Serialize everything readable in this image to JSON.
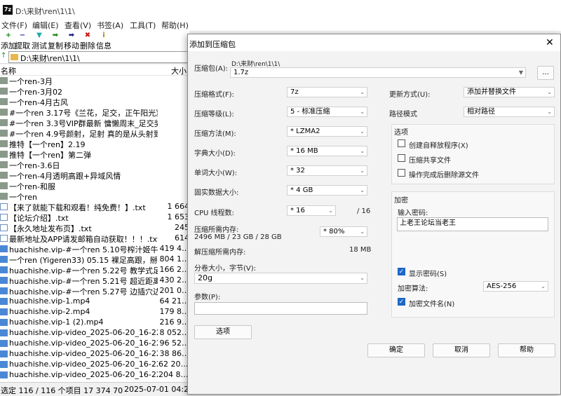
{
  "main": {
    "app_icon": "7z",
    "title": "D:\\来财\\ren\\1\\1\\",
    "menu": [
      "文件(F)",
      "编辑(E)",
      "查看(V)",
      "书签(A)",
      "工具(T)",
      "帮助(H)"
    ],
    "toolbar": [
      {
        "icon": "+",
        "label": "添加"
      },
      {
        "icon": "−",
        "label": "提取"
      },
      {
        "icon": "▼",
        "label": "测试"
      },
      {
        "icon": "➡",
        "label": "复制"
      },
      {
        "icon": "➡",
        "label": "移动"
      },
      {
        "icon": "✖",
        "label": "删除"
      },
      {
        "icon": "i",
        "label": "信息"
      }
    ],
    "address": "D:\\来财\\ren\\1\\1\\",
    "columns": {
      "name": "名称",
      "size": "大小"
    },
    "files": [
      {
        "type": "folder",
        "name": "一个ren-3月",
        "size": ""
      },
      {
        "type": "folder",
        "name": "一个ren-3月02",
        "size": ""
      },
      {
        "type": "folder",
        "name": "一个ren-4月古风",
        "size": ""
      },
      {
        "type": "folder",
        "name": "#一个ren 3.17号《兰花，足交，正午阳光》…",
        "size": ""
      },
      {
        "type": "folder",
        "name": "#一个ren 3.3号VIP群最新 慵懒周末_足交奖…",
        "size": ""
      },
      {
        "type": "folder",
        "name": "#一个ren 4.9号颜射，足射 真的是从头射到…",
        "size": ""
      },
      {
        "type": "folder",
        "name": "推特【一个ren】2.19",
        "size": ""
      },
      {
        "type": "folder",
        "name": "推特【一个ren】第二弹",
        "size": ""
      },
      {
        "type": "folder",
        "name": "一个ren-3.6日",
        "size": ""
      },
      {
        "type": "folder",
        "name": "一个ren-4月透明高跟+异域风情",
        "size": ""
      },
      {
        "type": "folder",
        "name": "一个ren-和服",
        "size": ""
      },
      {
        "type": "folder",
        "name": "一个ren",
        "size": ""
      },
      {
        "type": "file",
        "name": "【来了就能下载和观看！纯免费！】.txt",
        "size": "1 664"
      },
      {
        "type": "file",
        "name": "【论坛介绍】.txt",
        "size": "1 653"
      },
      {
        "type": "file",
        "name": "【永久地址发布页】.txt",
        "size": "245"
      },
      {
        "type": "file",
        "name": "最新地址及APP请发邮箱自动获取！！！.txt",
        "size": "614"
      },
      {
        "type": "media",
        "name": "huachishe.vip-#一个ren 5.10号榨汁姬牛奶…",
        "size": "419 4…"
      },
      {
        "type": "media",
        "name": "一个ren (Yigeren33) 05.15 裸足高跟，掰穴…",
        "size": "804 1…"
      },
      {
        "type": "media",
        "name": "huachishe.vip-#一个ren 5.22号 教学式足交…",
        "size": "166 2…"
      },
      {
        "type": "media",
        "name": "huachishe.vip-#一个ren 5.21号 超近距离口…",
        "size": "430 2…"
      },
      {
        "type": "media",
        "name": "huachishe.vip-#一个ren 5.27号 边插穴边玩…",
        "size": "201 0…"
      },
      {
        "type": "media",
        "name": "huachishe.vip-1.mp4",
        "size": "64 21…"
      },
      {
        "type": "media",
        "name": "huachishe.vip-2.mp4",
        "size": "179 8…"
      },
      {
        "type": "media",
        "name": "huachishe.vip-1 (2).mp4",
        "size": "216 9…"
      },
      {
        "type": "media",
        "name": "huachishe.vip-video_2025-06-20_16-22-1…",
        "size": "8 052…"
      },
      {
        "type": "media",
        "name": "huachishe.vip-video_2025-06-20_16-22-1…",
        "size": "96 52…"
      },
      {
        "type": "media",
        "name": "huachishe.vip-video_2025-06-20_16-22-1…",
        "size": "38 86…"
      },
      {
        "type": "media",
        "name": "huachishe.vip-video_2025-06-20_16-22-1…",
        "size": "62 20… 2025-…  2025-…"
      },
      {
        "type": "media",
        "name": "huachishe.vip-video_2025-06-20_16-22-1…",
        "size": "204 8… 2025-…  2025-…"
      }
    ],
    "status": {
      "selected": "选定 116 / 116 个项目 17 374 70",
      "date": "2025-07-01 04:29:38"
    }
  },
  "dialog": {
    "title": "添加到压缩包",
    "close": "✕",
    "archive_label": "压缩包(A):",
    "archive_path": "D:\\来财\\ren\\1\\1\\",
    "archive_name": "1.7z",
    "browse": "...",
    "left": [
      {
        "label": "压缩格式(F):",
        "value": "7z"
      },
      {
        "label": "压缩等级(L):",
        "value": "5 - 标准压缩"
      },
      {
        "label": "压缩方法(M):",
        "value": "*  LZMA2"
      },
      {
        "label": "字典大小(D):",
        "value": "*  16 MB"
      },
      {
        "label": "单词大小(W):",
        "value": "*  32"
      },
      {
        "label": "固实数据大小:",
        "value": "*  4 GB"
      }
    ],
    "threads_label": "CPU 线程数:",
    "threads_value": "*  16",
    "threads_max": "/ 16",
    "mem_compress_label": "压缩所需内存:",
    "mem_compress_detail": "2496 MB / 23 GB / 28 GB",
    "mem_percent": "* 80%",
    "mem_decompress_label": "解压缩所需内存:",
    "mem_decompress_value": "18 MB",
    "split_label": "分卷大小，字节(V):",
    "split_value": "20g",
    "params_label": "参数(P):",
    "params_value": "",
    "options_button": "选项",
    "update_label": "更新方式(U):",
    "update_value": "添加并替换文件",
    "path_label": "路径模式",
    "path_value": "相对路径",
    "options_group": "选项",
    "options": [
      {
        "label": "创建自释放程序(X)",
        "checked": false
      },
      {
        "label": "压缩共享文件",
        "checked": false
      },
      {
        "label": "操作完成后删除源文件",
        "checked": false
      }
    ],
    "encrypt_group": "加密",
    "password_label": "输入密码:",
    "password_value": "上老王论坛当老王",
    "show_password": "显示密码(S)",
    "encrypt_method_label": "加密算法:",
    "encrypt_method": "AES-256",
    "encrypt_names": "加密文件名(N)",
    "ok": "确定",
    "cancel": "取消",
    "help": "帮助"
  },
  "colors": {
    "accent": "#1e66c8",
    "folder": "#8a9a8a",
    "media": "#4a88d6"
  }
}
